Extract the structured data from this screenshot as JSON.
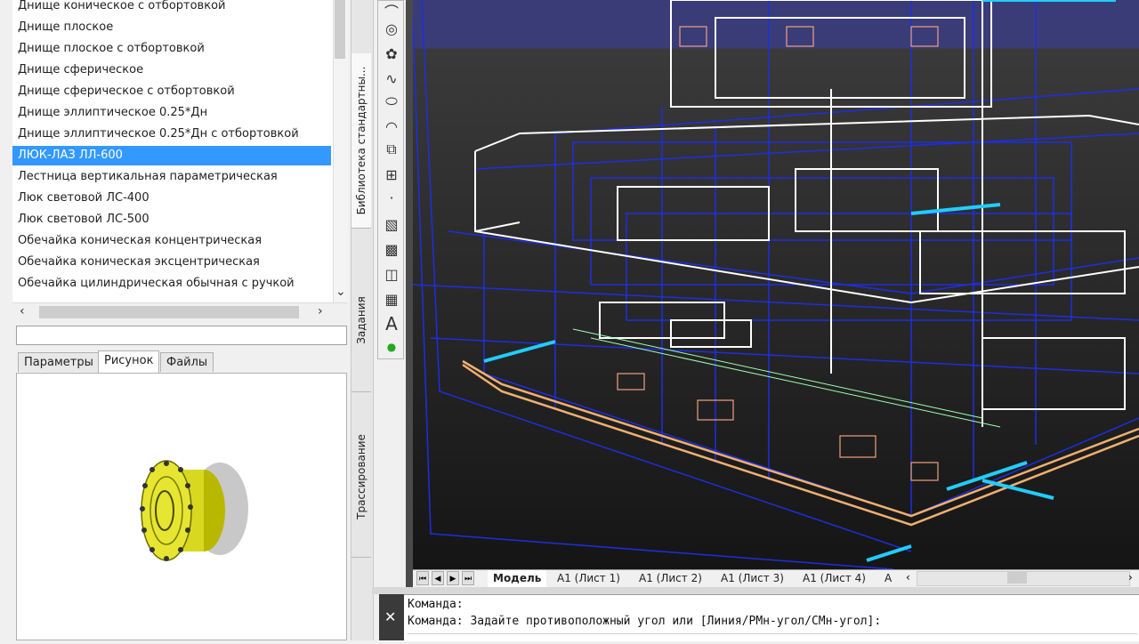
{
  "library": {
    "items": [
      "Днище коническое с отбортовкой",
      "Днище плоское",
      "Днище плоское с отбортовкой",
      "Днище сферическое",
      "Днище сферическое с отбортовкой",
      "Днище эллиптическое 0.25*Дн",
      "Днище эллиптическое 0.25*Дн с отбортовкой",
      "ЛЮК-ЛАЗ ЛЛ-600",
      "Лестница вертикальная параметрическая",
      "Люк световой ЛС-400",
      "Люк световой ЛС-500",
      "Обечайка коническая концентрическая",
      "Обечайка коническая эксцентрическая",
      "Обечайка цилиндрическая обычная с ручкой"
    ],
    "selected_index": 7,
    "filter_value": ""
  },
  "tabs": {
    "params": "Параметры",
    "picture": "Рисунок",
    "files": "Файлы",
    "active": "picture"
  },
  "side_tabs": {
    "library": "Библиотека стандартны...",
    "tasks": "Задания",
    "routing": "Трассирование"
  },
  "layout_tabs": [
    "Модель",
    "А1 (Лист 1)",
    "А1 (Лист 2)",
    "А1 (Лист 3)",
    "А1 (Лист 4)",
    "А"
  ],
  "command": {
    "line1": "Команда:",
    "line2": "Команда: Задайте противоположный угол или [Линия/РМн-угол/СМн-угол]:"
  },
  "colors": {
    "selection": "#3399ff",
    "viewport_bg": "#2b2b2b",
    "wire_blue": "#1e2ee0",
    "wire_white": "#ffffff",
    "wire_orange": "#f0b070",
    "wire_cyan": "#22ccff"
  }
}
